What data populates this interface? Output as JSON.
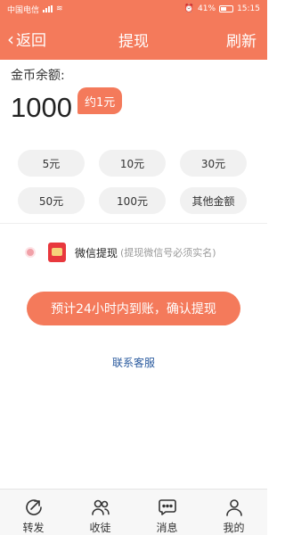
{
  "statusbar": {
    "carrier": "中国电信",
    "battery": "41%",
    "time": "15:15"
  },
  "nav": {
    "back_label": "返回",
    "title": "提现",
    "refresh_label": "刷新"
  },
  "balance": {
    "label": "金币余额:",
    "amount": "1000",
    "approx": "约1元"
  },
  "amounts": [
    "5元",
    "10元",
    "30元",
    "50元",
    "100元",
    "其他金额"
  ],
  "payment": {
    "method": "微信提现",
    "note": "(提现微信号必须实名)"
  },
  "confirm_label": "预计24小时内到账，确认提现",
  "contact_label": "联系客服",
  "tabs": [
    {
      "label": "转发",
      "icon": "share-icon"
    },
    {
      "label": "收徒",
      "icon": "users-icon"
    },
    {
      "label": "消息",
      "icon": "message-icon"
    },
    {
      "label": "我的",
      "icon": "user-icon"
    }
  ],
  "colors": {
    "accent": "#f47a5b",
    "link": "#2a5a9e"
  }
}
